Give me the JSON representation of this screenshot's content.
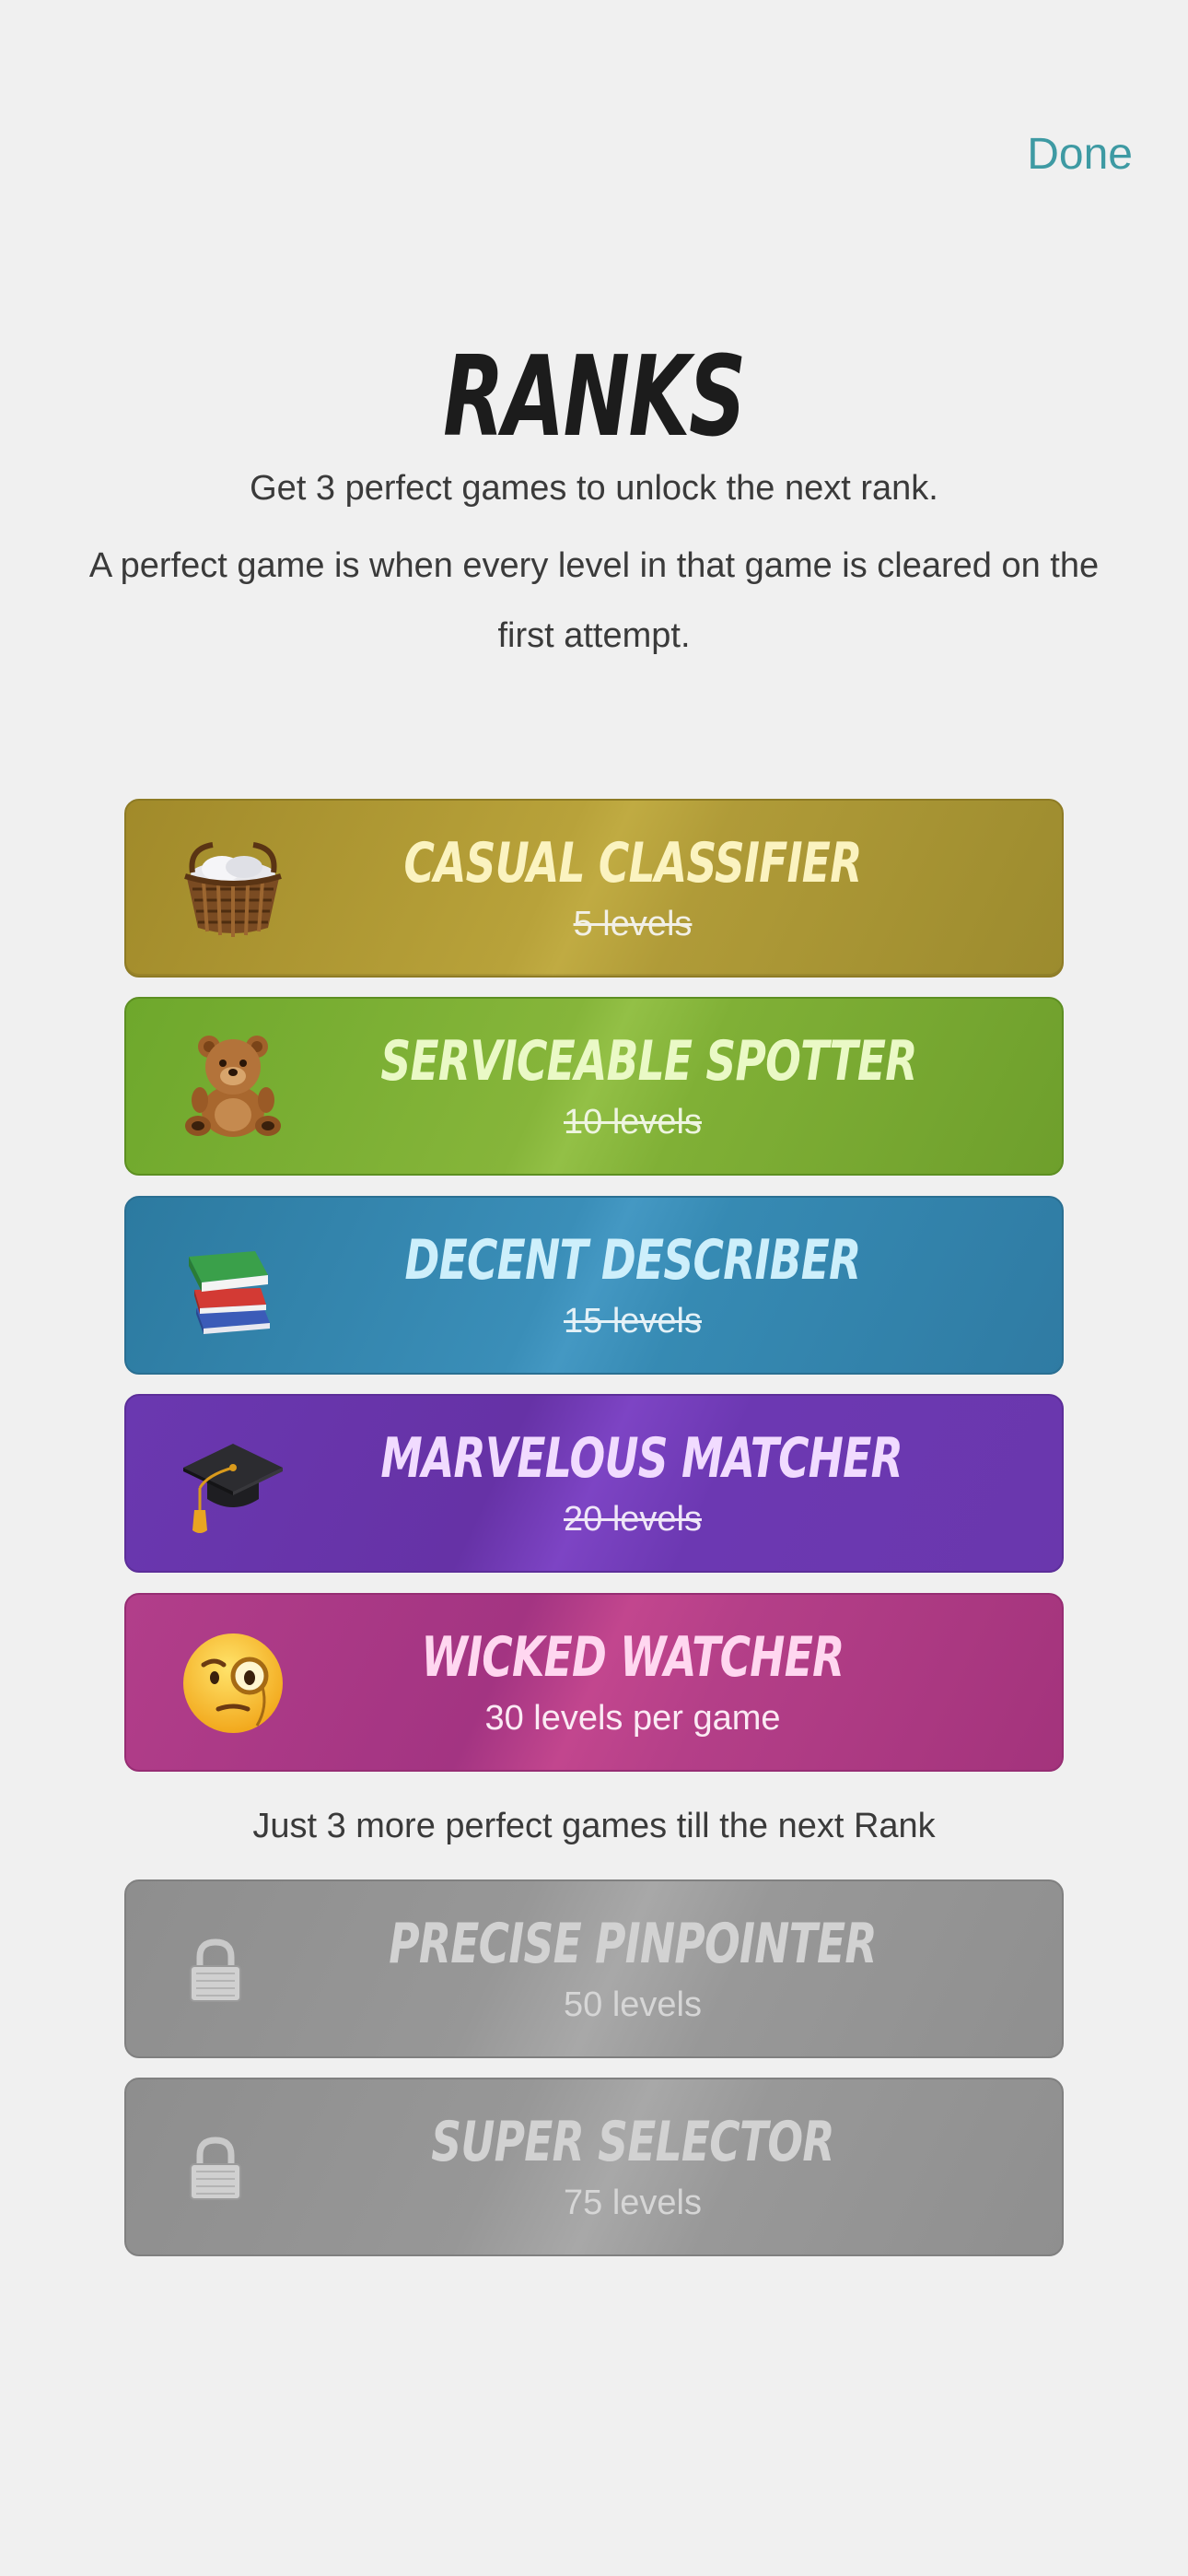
{
  "header": {
    "done_label": "Done"
  },
  "title": "RANKS",
  "intro": {
    "line1": "Get 3 perfect games to unlock the next rank.",
    "line2": "A perfect game is when every level in that game is cleared on the first attempt."
  },
  "ranks": [
    {
      "name": "CASUAL CLASSIFIER",
      "levels": "5 levels",
      "state": "completed",
      "icon": "laundry-basket-icon",
      "color": "#b09b38"
    },
    {
      "name": "SERVICEABLE SPOTTER",
      "levels": "10 levels",
      "state": "completed",
      "icon": "teddy-bear-icon",
      "color": "#86b53a"
    },
    {
      "name": "DECENT DESCRIBER",
      "levels": "15 levels",
      "state": "completed",
      "icon": "books-icon",
      "color": "#3a8eb8"
    },
    {
      "name": "MARVELOUS MATCHER",
      "levels": "20 levels",
      "state": "completed",
      "icon": "graduation-cap-icon",
      "color": "#7240b8"
    },
    {
      "name": "WICKED WATCHER",
      "levels": "30 levels per game",
      "state": "current",
      "icon": "face-with-monocle-icon",
      "color": "#b43f88"
    }
  ],
  "next_rank_note": "Just 3 more perfect games till the next Rank",
  "locked_ranks": [
    {
      "name": "PRECISE PINPOINTER",
      "levels": "50 levels",
      "state": "locked",
      "icon": "lock-icon"
    },
    {
      "name": "SUPER SELECTOR",
      "levels": "75 levels",
      "state": "locked",
      "icon": "lock-icon"
    }
  ]
}
